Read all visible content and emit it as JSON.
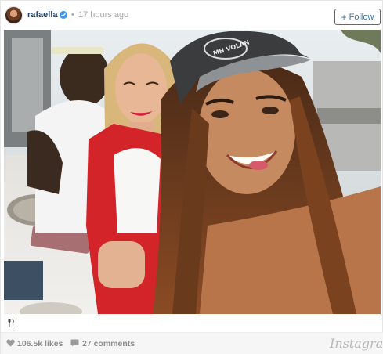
{
  "post": {
    "username": "rafaella",
    "separator": "•",
    "time": "17 hours ago",
    "follow_label": "Follow",
    "follow_plus": "+",
    "caption_icon": "fork-knife-icon",
    "likes": "106.5k likes",
    "comments": "27 comments",
    "brand": "Instagram"
  },
  "photo": {
    "cap_text": "MH VOLAN"
  },
  "colors": {
    "username": "#1c3d5f",
    "verified": "#3897f0",
    "follow_border": "#4a6f94",
    "footer_bg": "#f6f6f6",
    "muted_text": "#8c8c8c"
  }
}
